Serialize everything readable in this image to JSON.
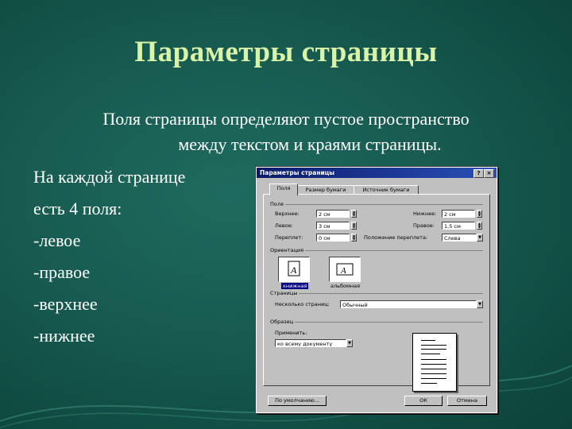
{
  "slide": {
    "title": "Параметры страницы",
    "subtitle_line1": "Поля страницы определяют пустое пространство",
    "subtitle_line2": "между текстом и краями страницы.",
    "bullets": [
      "На каждой странице",
      "есть 4 поля:",
      "-левое",
      "-правое",
      "-верхнее",
      "-нижнее"
    ],
    "colors": {
      "background": "#175a50",
      "title": "#d9f3a8",
      "text": "#ffffff"
    }
  },
  "dialog": {
    "title": "Параметры страницы",
    "help_icon": "?",
    "close_icon": "×",
    "tabs": [
      "Поля",
      "Размер бумаги",
      "Источник бумаги"
    ],
    "margins": {
      "group_label": "Поля",
      "top_label": "Верхнее:",
      "top_value": "2 см",
      "left_label": "Левое:",
      "left_value": "3 см",
      "gutter_label": "Переплет:",
      "gutter_value": "0 см",
      "bottom_label": "Нижнее:",
      "bottom_value": "2 см",
      "right_label": "Правое:",
      "right_value": "1,5 см",
      "gutter_pos_label": "Положение переплета:",
      "gutter_pos_value": "Слева"
    },
    "orientation": {
      "group_label": "Ориентация",
      "portrait": "книжная",
      "landscape": "альбомная"
    },
    "pages": {
      "group_label": "Страницы",
      "multiple_label": "Несколько страниц:",
      "multiple_value": "Обычный"
    },
    "preview": {
      "group_label": "Образец",
      "apply_label": "Применить:",
      "apply_value": "ко всему документу"
    },
    "buttons": {
      "default": "По умолчанию...",
      "ok": "ОК",
      "cancel": "Отмена"
    }
  }
}
